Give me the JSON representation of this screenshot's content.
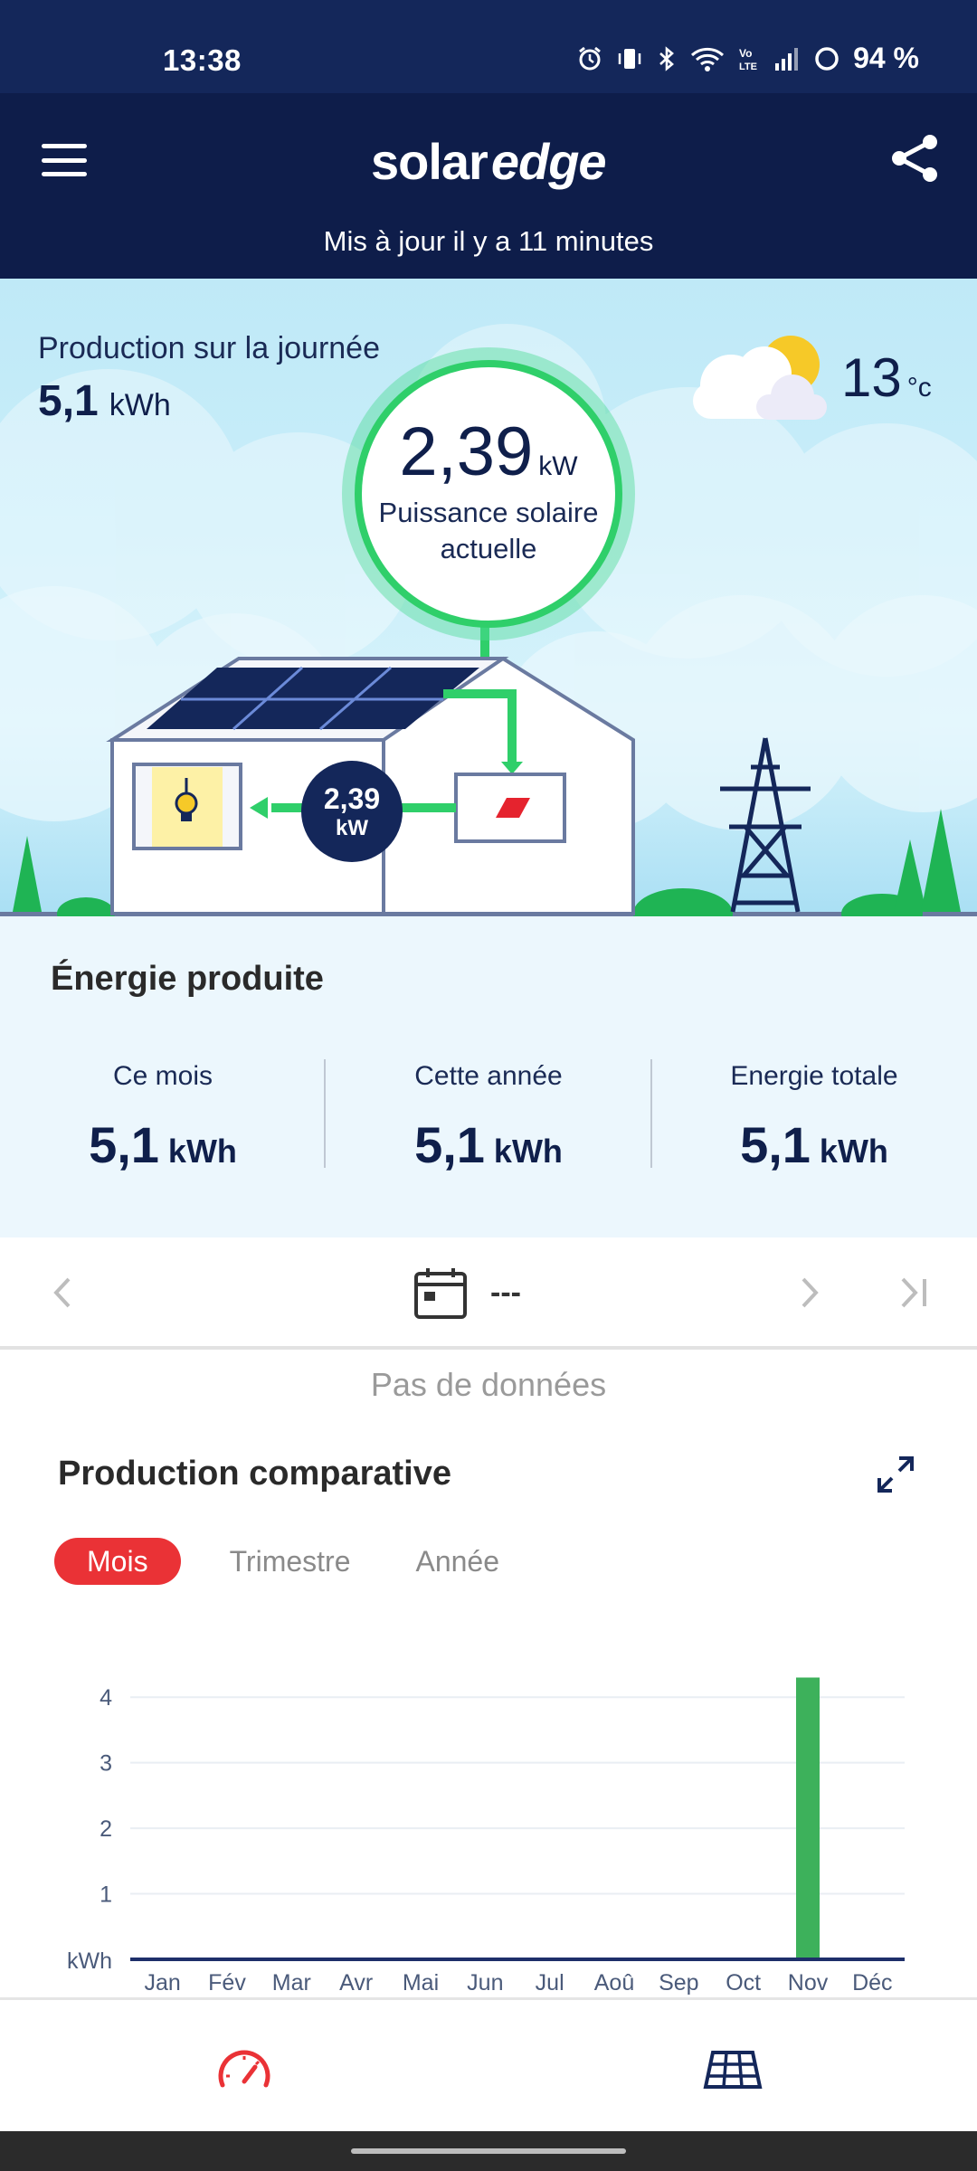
{
  "status_bar": {
    "time": "13:38",
    "battery": "94 %",
    "icons": [
      "alarm-icon",
      "vibrate-icon",
      "bluetooth-icon",
      "wifi-icon",
      "volte-icon",
      "signal-icon",
      "battery-ring-icon"
    ]
  },
  "header": {
    "logo_part1": "solar",
    "logo_part2": "edge",
    "updated": "Mis à jour il y a 11 minutes"
  },
  "hero": {
    "day_label": "Production sur la journée",
    "day_value": "5,1",
    "day_unit": "kWh",
    "temperature": "13",
    "temperature_unit": "°c",
    "weather_icon": "partly-cloudy-icon",
    "power_value": "2,39",
    "power_unit": "kW",
    "power_label": "Puissance solaire actuelle",
    "house_value": "2,39",
    "house_unit": "kW"
  },
  "energy": {
    "title": "Énergie produite",
    "month_label": "Ce mois",
    "month_value": "5,1",
    "year_label": "Cette année",
    "year_value": "5,1",
    "total_label": "Energie totale",
    "total_value": "5,1",
    "unit": "kWh"
  },
  "date_nav": {
    "date_text": "---",
    "no_data": "Pas de données"
  },
  "comparative": {
    "title": "Production comparative",
    "tabs": [
      "Mois",
      "Trimestre",
      "Année"
    ],
    "active_tab": "Mois"
  },
  "chart_data": {
    "type": "bar",
    "categories": [
      "Jan",
      "Fév",
      "Mar",
      "Avr",
      "Mai",
      "Jun",
      "Jul",
      "Aoû",
      "Sep",
      "Oct",
      "Nov",
      "Déc"
    ],
    "values": [
      0,
      0,
      0,
      0,
      0,
      0,
      0,
      0,
      0,
      0,
      4.3,
      0
    ],
    "ylabel": "kWh",
    "yticks": [
      1,
      2,
      3,
      4
    ],
    "ylim": [
      0,
      4.5
    ],
    "bar_color": "#3db15b",
    "grid": true
  },
  "colors": {
    "navy": "#0e1d4a",
    "accent_red": "#ea3236",
    "green": "#2fcf6a"
  }
}
